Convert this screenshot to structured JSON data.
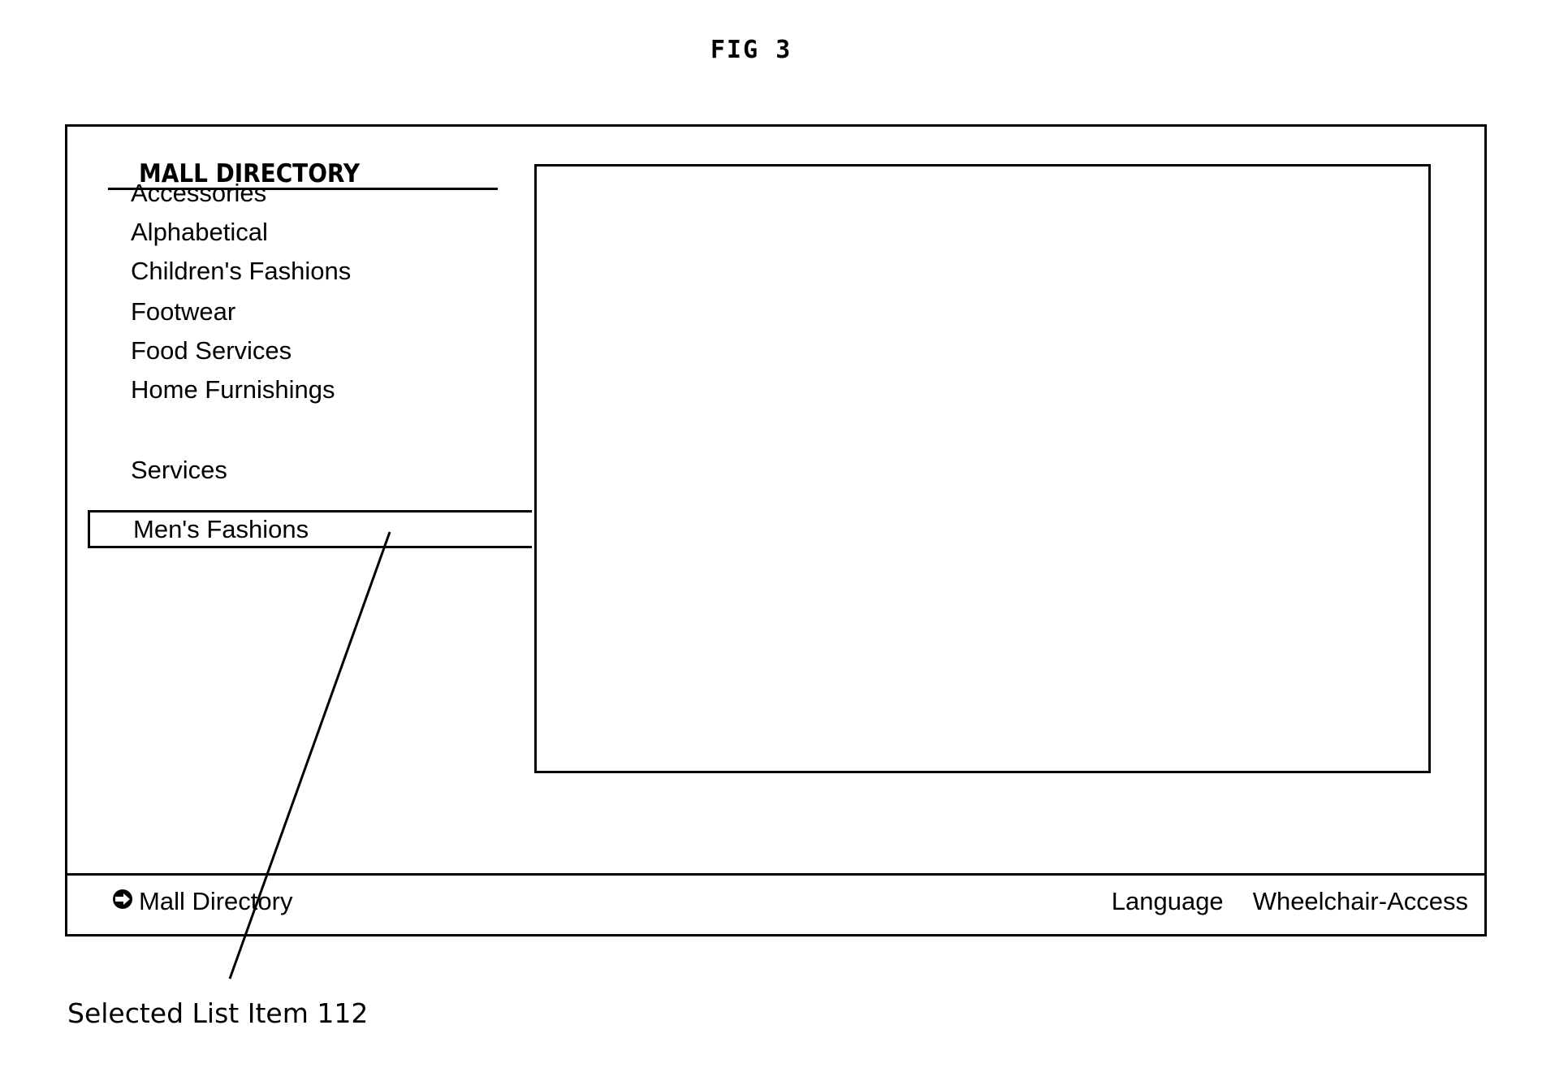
{
  "figure": {
    "title": "FIG 3",
    "callout_label": "Selected List Item 112"
  },
  "screen": {
    "heading": "MALL DIRECTORY",
    "menu": [
      {
        "label": "Accessories",
        "selected": false
      },
      {
        "label": "Alphabetical",
        "selected": false
      },
      {
        "label": "Children's Fashions",
        "selected": false
      },
      {
        "label": "Footwear",
        "selected": false
      },
      {
        "label": "Food Services",
        "selected": false
      },
      {
        "label": "Home Furnishings",
        "selected": false
      },
      {
        "label": "Men's Fashions",
        "selected": true
      },
      {
        "label": "Services",
        "selected": false
      }
    ],
    "footer": {
      "home_icon": "circle-arrow-right-icon",
      "home_label": "Mall Directory",
      "language_label": "Language",
      "accessibility_label": "Wheelchair-Access"
    }
  }
}
